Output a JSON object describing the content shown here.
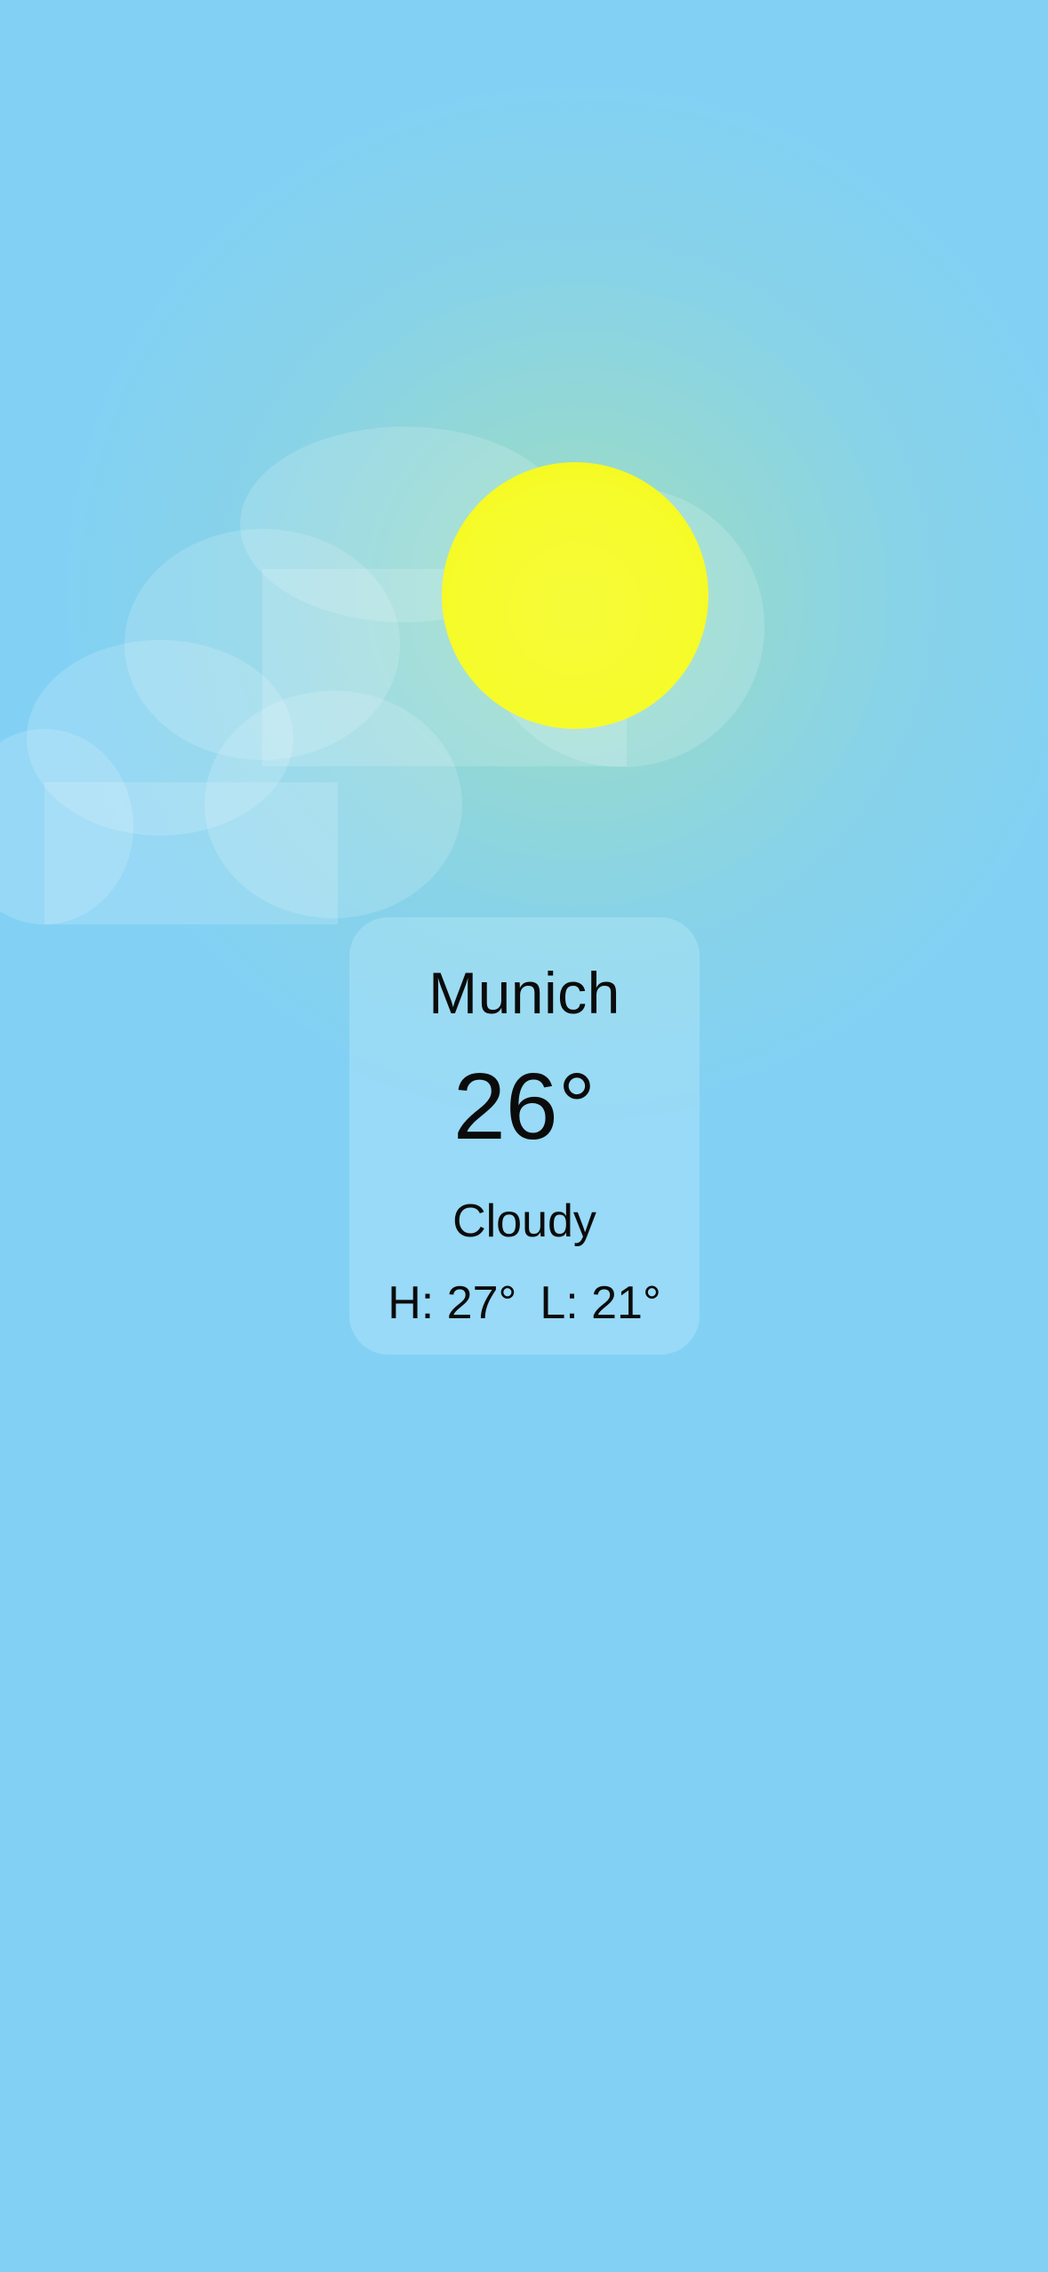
{
  "weather": {
    "city": "Munich",
    "temperature": "26°",
    "condition": "Cloudy",
    "high": "H: 27°",
    "low": "L: 21°"
  },
  "colors": {
    "sky": "#82d1f5",
    "sun": "#f6fb2c",
    "card": "#bfeaf9"
  },
  "icons": [
    "sun-icon",
    "cloud-icon"
  ]
}
